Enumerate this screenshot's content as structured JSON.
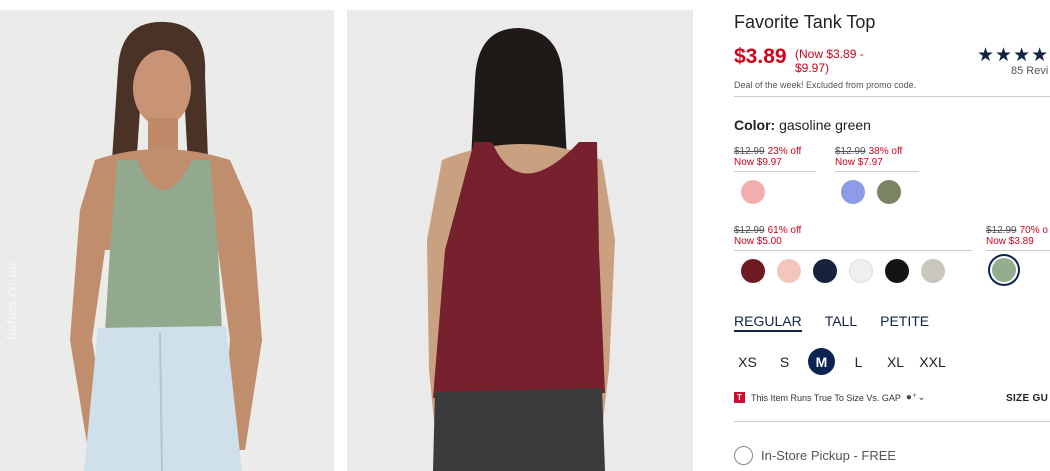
{
  "product": {
    "title": "Favorite Tank Top",
    "price": "$3.89",
    "price_range": "(Now $3.89 - $9.97)",
    "rating_stars": "★★★★",
    "reviews": "85 Revi",
    "deal_note": "Deal of the week! Excluded from promo code.",
    "watermark": "ladies.co.ua"
  },
  "color": {
    "label": "Color:",
    "value": "gasoline green",
    "groups": [
      {
        "old_price": "$12.99",
        "discount": "23% off",
        "now": "Now $9.97",
        "swatches": [
          "#f3aeb0"
        ]
      },
      {
        "old_price": "$12.99",
        "discount": "38% off",
        "now": "Now $7.97",
        "swatches": [
          "#8d9ce8",
          "#7b8462"
        ]
      },
      {
        "old_price": "$12.99",
        "discount": "61% off",
        "now": "Now $5.00",
        "swatches": [
          "#6e1a23",
          "#f3c6bb",
          "#17223c",
          "#efefef",
          "#141414",
          "#c9c6c0"
        ]
      },
      {
        "old_price": "$12.99",
        "discount": "70% o",
        "now": "Now $3.89",
        "swatches": [
          "#93ad8e"
        ],
        "selected": 0
      }
    ]
  },
  "fits": [
    "REGULAR",
    "TALL",
    "PETITE"
  ],
  "active_fit": "REGULAR",
  "sizes": [
    "XS",
    "S",
    "M",
    "L",
    "XL",
    "XXL"
  ],
  "selected_size": "M",
  "fit_note": {
    "badge": "T",
    "text": "This Item Runs True To Size Vs. GAP",
    "icon_text": "●⁺⌄",
    "size_guide": "SIZE GU"
  },
  "pickup": {
    "label": "In-Store Pickup - FREE"
  }
}
